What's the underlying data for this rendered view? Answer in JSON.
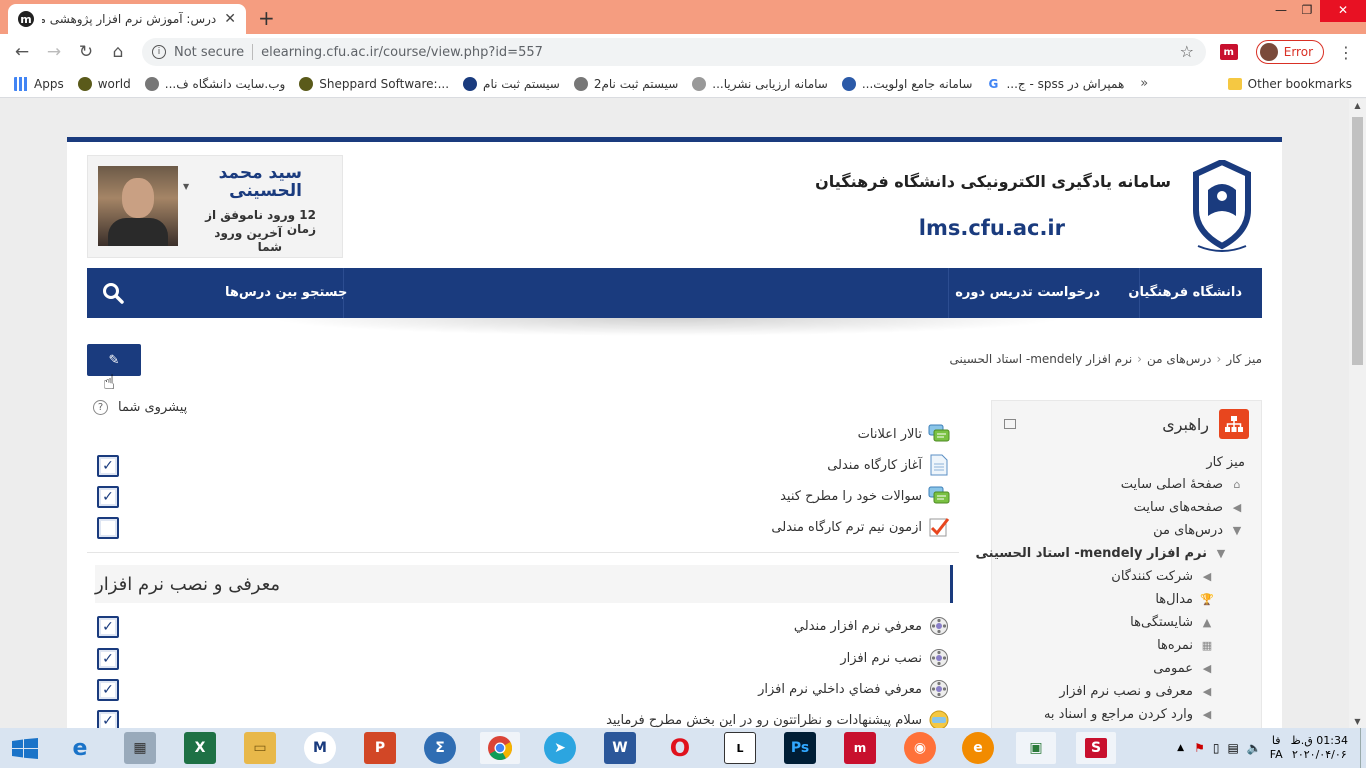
{
  "browser": {
    "tab_title": "درس: آموزش نرم افزار پژوهشی مند",
    "tab_favicon": "m",
    "address_security": "Not secure",
    "url": "elearning.cfu.ac.ir/course/view.php?id=557",
    "profile_status": "Error",
    "bookmarks": [
      {
        "label": "Apps",
        "icon": "apps-grid-icon"
      },
      {
        "label": "world",
        "icon": "bookmark-icon"
      },
      {
        "label": "وب.سایت دانشگاه ف...",
        "icon": "globe-icon"
      },
      {
        "label": "Sheppard Software:...",
        "icon": "bookmark-icon"
      },
      {
        "label": "سیستم ثبت نام",
        "icon": "bookmark-icon"
      },
      {
        "label": "سیستم ثبت نام2",
        "icon": "globe-icon"
      },
      {
        "label": "سامانه ارزیابی نشریا...",
        "icon": "bookmark-icon"
      },
      {
        "label": "سامانه جامع اولویت...",
        "icon": "bookmark-icon"
      },
      {
        "label": "همپراش در spss - ج...",
        "icon": "google-icon"
      }
    ],
    "other_bookmarks": "Other bookmarks",
    "more": "»"
  },
  "header": {
    "title": "سامانه یادگیری الکترونیکی دانشگاه فرهنگیان",
    "site": "lms.cfu.ac.ir"
  },
  "user": {
    "name": "سید محمد الحسینی",
    "info_line1": "12 ورود ناموفق از زمان",
    "info_line2": "آخرین ورود شما"
  },
  "navbar": {
    "item1": "دانشگاه فرهنگیان",
    "item2": "درخواست تدریس دوره",
    "search": "جستجو بین درس‌ها"
  },
  "breadcrumb": {
    "item1": "میز کار",
    "item2": "درس‌های من",
    "item3": "نرم افزار mendely- استاد الحسینی"
  },
  "progress_label": "پیشروی شما",
  "activities_top": [
    {
      "label": "تالار اعلانات",
      "icon": "forum-icon",
      "check": "none"
    },
    {
      "label": "آغاز کارگاه مندلی",
      "icon": "page-icon",
      "check": "checked"
    },
    {
      "label": "سوالات خود را مطرح کنید",
      "icon": "forum-icon",
      "check": "checked"
    },
    {
      "label": "ازمون نیم ترم کارگاه مندلی",
      "icon": "quiz-icon",
      "check": "unchecked"
    }
  ],
  "section_title": "معرفی و نصب نرم افزار",
  "activities_section": [
    {
      "label": "معرفي نرم افزار مندلي",
      "icon": "video-icon",
      "check": "checked"
    },
    {
      "label": "نصب نرم افزار",
      "icon": "video-icon",
      "check": "checked"
    },
    {
      "label": "معرفي فضاي داخلي نرم افزار",
      "icon": "video-icon",
      "check": "checked"
    },
    {
      "label": "سلام پیشنهادات و نظراتتون رو در این بخش مطرح فرمایید",
      "icon": "chat-icon",
      "check": "checked"
    }
  ],
  "nav_block": {
    "title": "راهبری",
    "items": [
      {
        "label": "میز کار"
      },
      {
        "label": "صفحهٔ اصلی سایت"
      },
      {
        "label": "صفحه‌های سایت"
      },
      {
        "label": "درس‌های من"
      },
      {
        "label": "نرم افزار mendely- استاد الحسینی"
      },
      {
        "label": "شرکت کنندگان"
      },
      {
        "label": "مدال‌ها"
      },
      {
        "label": "شایستگی‌ها"
      },
      {
        "label": "نمره‌ها"
      },
      {
        "label": "عمومی"
      },
      {
        "label": "معرفی و نصب نرم افزار"
      },
      {
        "label": "وارد کردن مراجع و اسناد به"
      }
    ]
  },
  "taskbar": {
    "clock_time": "01:34 ق.ظ",
    "clock_date": "۲۰۲۰/۰۴/۰۶",
    "lang": "FA",
    "lang_top": "فا"
  }
}
